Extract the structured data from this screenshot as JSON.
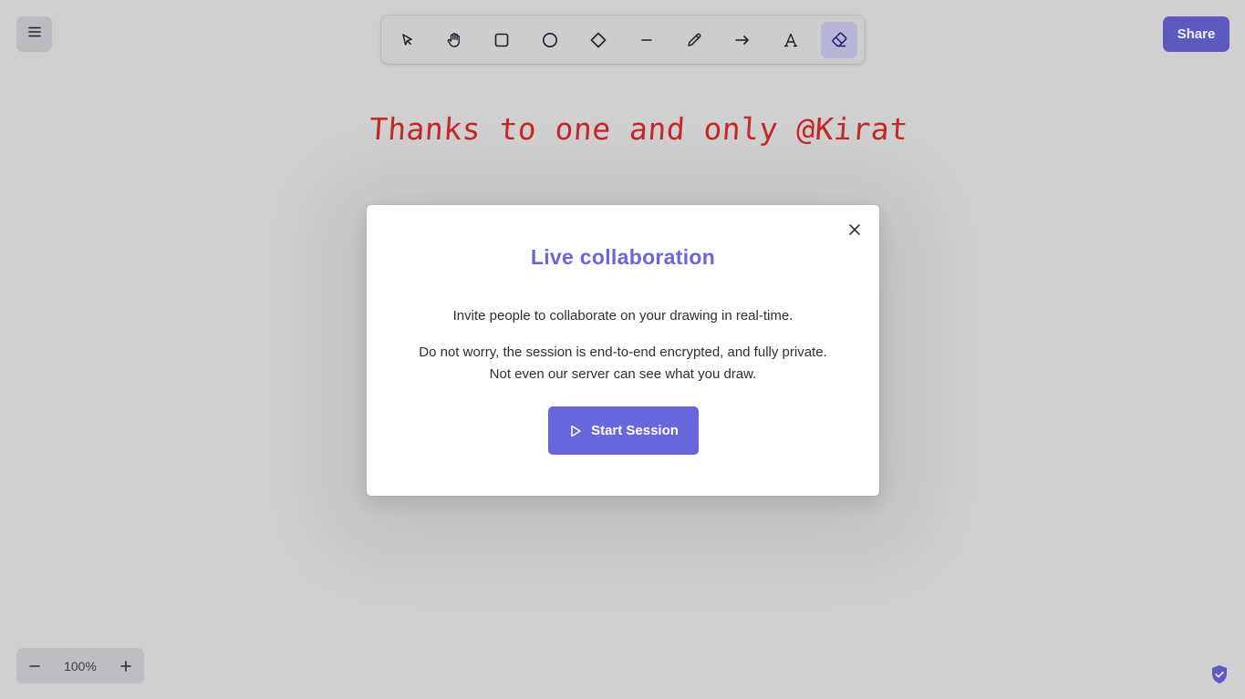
{
  "canvas": {
    "heading_text": "Thanks to one and only @Kirat",
    "heading_color": "#c62828",
    "background": "#d0d0d1"
  },
  "menu": {
    "icon": "hamburger-icon"
  },
  "toolbar": {
    "tools": [
      {
        "name": "selection",
        "icon": "pointer-icon"
      },
      {
        "name": "hand",
        "icon": "hand-icon"
      },
      {
        "name": "rectangle",
        "icon": "square-icon"
      },
      {
        "name": "ellipse",
        "icon": "circle-icon"
      },
      {
        "name": "diamond",
        "icon": "diamond-icon"
      },
      {
        "name": "line",
        "icon": "line-icon"
      },
      {
        "name": "draw",
        "icon": "pencil-icon"
      },
      {
        "name": "arrow",
        "icon": "arrow-icon"
      },
      {
        "name": "text",
        "icon": "text-icon"
      },
      {
        "name": "eraser",
        "icon": "eraser-icon",
        "active": true
      }
    ]
  },
  "share": {
    "label": "Share",
    "color": "#5d5abf"
  },
  "zoom": {
    "value": "100%",
    "minus_icon": "minus-icon",
    "plus_icon": "plus-icon"
  },
  "footer": {
    "icon": "shield-check-icon"
  },
  "modal": {
    "title": "Live collaboration",
    "paragraph1": "Invite people to collaborate on your drawing in real-time.",
    "paragraph2": "Do not worry, the session is end-to-end encrypted, and fully private. Not even our server can see what you draw.",
    "start_button_label": "Start Session",
    "accent": "#6965db",
    "close_icon": "close-icon"
  }
}
